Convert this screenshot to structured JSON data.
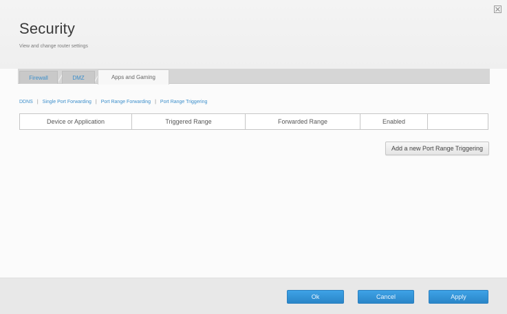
{
  "window": {
    "close_icon": "close-icon"
  },
  "header": {
    "title": "Security",
    "subtitle": "View and change router settings"
  },
  "tabs": [
    {
      "label": "Firewall",
      "active": false
    },
    {
      "label": "DMZ",
      "active": false
    },
    {
      "label": "Apps and Gaming",
      "active": true
    }
  ],
  "subnav": [
    {
      "label": "DDNS"
    },
    {
      "label": "Single Port Forwarding"
    },
    {
      "label": "Port Range Forwarding"
    },
    {
      "label": "Port Range Triggering"
    }
  ],
  "table": {
    "columns": [
      "Device or Application",
      "Triggered Range",
      "Forwarded Range",
      "Enabled",
      ""
    ],
    "rows": []
  },
  "actions": {
    "add_label": "Add a new Port Range Triggering"
  },
  "footer": {
    "ok_label": "Ok",
    "cancel_label": "Cancel",
    "apply_label": "Apply"
  },
  "colors": {
    "accent": "#3b8ecb",
    "button_blue": "#2a86c8"
  }
}
